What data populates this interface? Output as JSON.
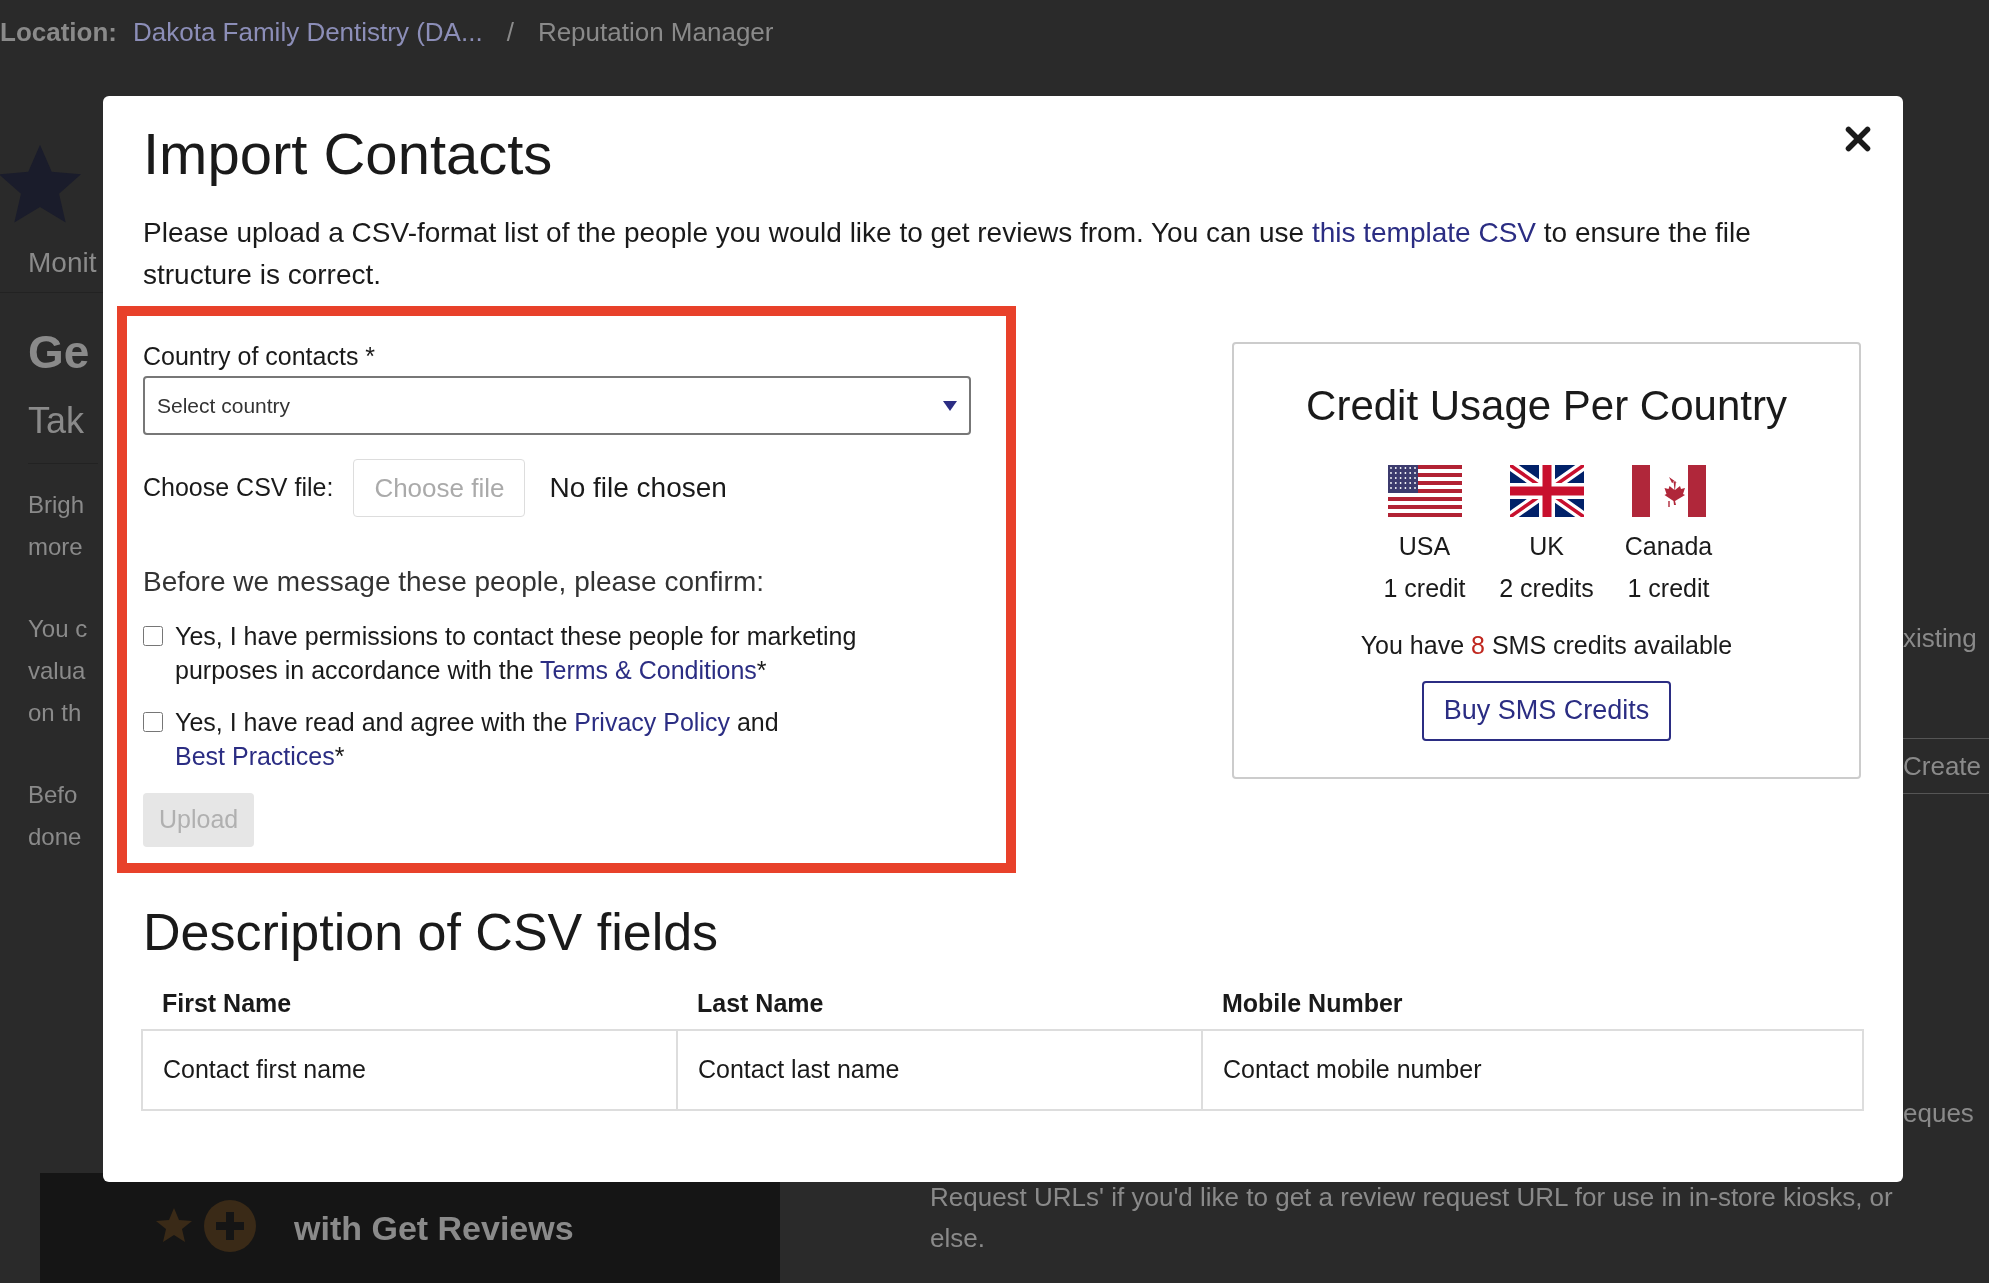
{
  "background": {
    "breadcrumb": {
      "label": "Location:",
      "location": "Dakota Family Dentistry (DA...",
      "separator": "/",
      "page": "Reputation Manager"
    },
    "tab": "Monit",
    "heading": "Ge",
    "subheading": "Tak",
    "left_paragraphs": [
      [
        "Brigh",
        "more"
      ],
      [
        "You c",
        "valua",
        "on th"
      ],
      [
        "Befo",
        "done"
      ]
    ],
    "banner_text": "with Get Reviews",
    "right_text": "xisting",
    "right_button": "Create",
    "right_fragment": "eques",
    "bottom_lines": [
      "Request URLs' if you'd like to get a review request URL for use in in-store kiosks, or",
      "else."
    ]
  },
  "modal": {
    "title": "Import Contacts",
    "intro": [
      {
        "text": "Please upload a CSV-format list of the people you would like to get reviews from. You can use ",
        "kind": "text"
      },
      {
        "text": "this template CSV",
        "kind": "link"
      },
      {
        "text": " to ensure the file structure is correct.",
        "kind": "text"
      }
    ],
    "form": {
      "country_label": "Country of contacts *",
      "country_select": {
        "placeholder": "Select country"
      },
      "file_label": "Choose CSV file:",
      "file_button": "Choose file",
      "file_status": "No file chosen",
      "confirm_heading": "Before we message these people, please confirm:",
      "confirmations": [
        {
          "checked": false,
          "parts": [
            {
              "text": "Yes, I have permissions to contact these people for marketing purposes in accordance with the ",
              "kind": "text"
            },
            {
              "text": "Terms & Conditions",
              "kind": "link"
            },
            {
              "text": "*",
              "kind": "text"
            }
          ]
        },
        {
          "checked": false,
          "parts": [
            {
              "text": "Yes, I have read and agree with the ",
              "kind": "text"
            },
            {
              "text": "Privacy Policy",
              "kind": "link"
            },
            {
              "text": " and ",
              "kind": "text"
            },
            {
              "text": "Best Practices",
              "kind": "link"
            },
            {
              "text": "*",
              "kind": "text"
            }
          ]
        }
      ],
      "upload_button": {
        "label": "Upload",
        "disabled": true
      }
    },
    "credits": {
      "title": "Credit Usage Per Country",
      "countries": [
        {
          "kind": "us",
          "name": "USA",
          "cost": "1 credit"
        },
        {
          "kind": "uk",
          "name": "UK",
          "cost": "2 credits"
        },
        {
          "kind": "ca",
          "name": "Canada",
          "cost": "1 credit"
        }
      ],
      "available": {
        "before": "You have ",
        "count": "8",
        "after": " SMS credits available"
      },
      "buy_button": "Buy SMS Credits"
    },
    "description": {
      "title": "Description of CSV fields",
      "columns": [
        "First Name",
        "Last Name",
        "Mobile Number"
      ],
      "rows": [
        [
          "Contact first name",
          "Contact last name",
          "Contact mobile number"
        ]
      ]
    }
  }
}
